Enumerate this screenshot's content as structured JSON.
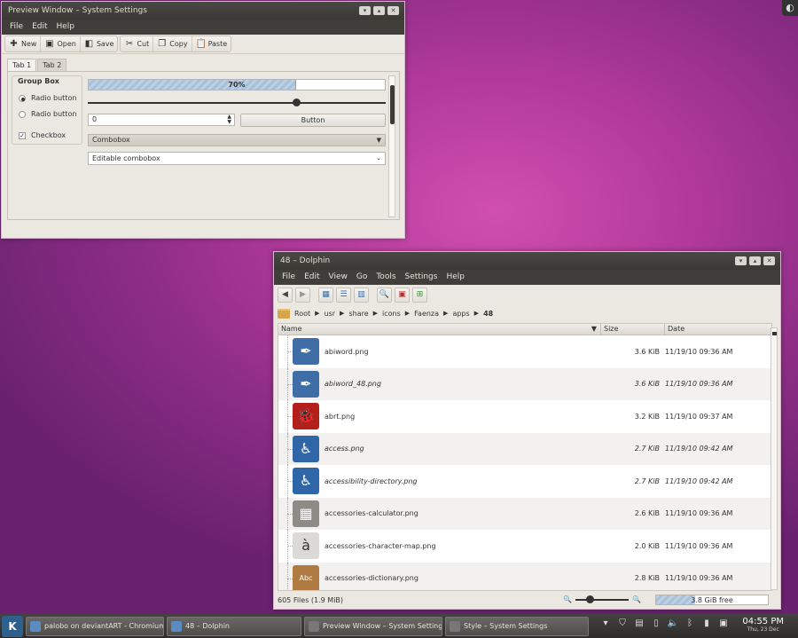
{
  "preview": {
    "title": "Preview Window – System Settings",
    "menu": [
      "File",
      "Edit",
      "Help"
    ],
    "toolbar": [
      {
        "label": "New",
        "icon": "new-icon"
      },
      {
        "label": "Open",
        "icon": "open-icon"
      },
      {
        "label": "Save",
        "icon": "save-icon"
      },
      {
        "label": "Cut",
        "icon": "cut-icon"
      },
      {
        "label": "Copy",
        "icon": "copy-icon"
      },
      {
        "label": "Paste",
        "icon": "paste-icon"
      }
    ],
    "tabs": [
      "Tab 1",
      "Tab 2"
    ],
    "group_box": "Group Box",
    "radio1": "Radio button",
    "radio2": "Radio button",
    "checkbox": "Checkbox",
    "progress_text": "70%",
    "progress_value": 0.7,
    "slider_value": 0.7,
    "spin_value": "0",
    "button": "Button",
    "combobox": "Combobox",
    "editable_combobox": "Editable combobox"
  },
  "dolphin": {
    "title": "48 – Dolphin",
    "menu": [
      "File",
      "Edit",
      "View",
      "Go",
      "Tools",
      "Settings",
      "Help"
    ],
    "breadcrumb": [
      "Root",
      "usr",
      "share",
      "icons",
      "Faenza",
      "apps",
      "48"
    ],
    "columns": {
      "name": "Name",
      "size": "Size",
      "date": "Date"
    },
    "files": [
      {
        "name": "abiword.png",
        "size": "3.6 KiB",
        "date": "11/19/10 09:36 AM",
        "italic": false,
        "color": "#3f6ea6",
        "glyph": "✒"
      },
      {
        "name": "abiword_48.png",
        "size": "3.6 KiB",
        "date": "11/19/10 09:36 AM",
        "italic": true,
        "color": "#3f6ea6",
        "glyph": "✒"
      },
      {
        "name": "abrt.png",
        "size": "3.2 KiB",
        "date": "11/19/10 09:37 AM",
        "italic": false,
        "color": "#b3201a",
        "glyph": "🐞"
      },
      {
        "name": "access.png",
        "size": "2.7 KiB",
        "date": "11/19/10 09:42 AM",
        "italic": true,
        "color": "#2f66a7",
        "glyph": "♿"
      },
      {
        "name": "accessibility-directory.png",
        "size": "2.7 KiB",
        "date": "11/19/10 09:42 AM",
        "italic": true,
        "color": "#2f66a7",
        "glyph": "♿"
      },
      {
        "name": "accessories-calculator.png",
        "size": "2.6 KiB",
        "date": "11/19/10 09:36 AM",
        "italic": false,
        "color": "#8d8b86",
        "glyph": "▦"
      },
      {
        "name": "accessories-character-map.png",
        "size": "2.0 KiB",
        "date": "11/19/10 09:36 AM",
        "italic": false,
        "color": "#dcdad6",
        "glyph": "à"
      },
      {
        "name": "accessories-dictionary.png",
        "size": "2.8 KiB",
        "date": "11/19/10 09:36 AM",
        "italic": false,
        "color": "#b07b43",
        "glyph": "Abc"
      }
    ],
    "status": "605 Files (1.9 MiB)",
    "free_space": "3.8 GiB free",
    "free_used": 0.35
  },
  "taskbar": {
    "tasks": [
      "palobo on deviantART - Chromium",
      "48 – Dolphin",
      "Preview Window – System Setting",
      "Style – System Settings"
    ],
    "time": "04:55 PM",
    "date": "Thu, 23 Dec"
  }
}
